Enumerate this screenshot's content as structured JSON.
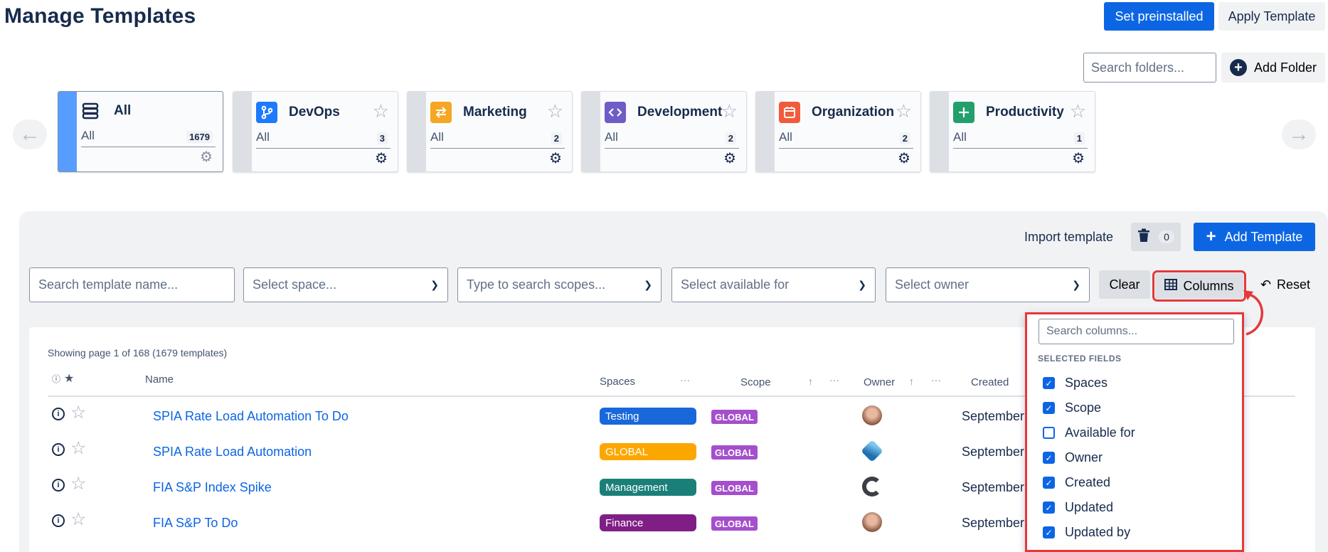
{
  "header": {
    "title": "Manage Templates",
    "set_preinstalled": "Set preinstalled",
    "apply_template": "Apply Template"
  },
  "folders_bar": {
    "search_placeholder": "Search folders...",
    "add_folder": "Add Folder"
  },
  "folders": [
    {
      "name": "All",
      "all_label": "All",
      "count": "1679",
      "icon": "stack-icon",
      "color": "#ffffff"
    },
    {
      "name": "DevOps",
      "all_label": "All",
      "count": "3",
      "icon": "git-branch-icon",
      "color": "#1d7afc"
    },
    {
      "name": "Marketing",
      "all_label": "All",
      "count": "2",
      "icon": "swap-arrows-icon",
      "color": "#f5a623"
    },
    {
      "name": "Development",
      "all_label": "All",
      "count": "2",
      "icon": "code-icon",
      "color": "#6e5dc6"
    },
    {
      "name": "Organization",
      "all_label": "All",
      "count": "2",
      "icon": "calendar-icon",
      "color": "#f15b3b"
    },
    {
      "name": "Productivity",
      "all_label": "All",
      "count": "1",
      "icon": "plus-icon",
      "color": "#22a06b"
    }
  ],
  "toolbar": {
    "import_template": "Import template",
    "trash_count": "0",
    "add_template": "Add Template"
  },
  "filters": {
    "name_placeholder": "Search template name...",
    "space_placeholder": "Select space...",
    "scope_placeholder": "Type to search scopes...",
    "available_placeholder": "Select available for",
    "owner_placeholder": "Select owner",
    "clear": "Clear",
    "columns": "Columns",
    "reset": "Reset"
  },
  "table": {
    "showing": "Showing page 1 of 168 (1679 templates)",
    "headers": {
      "name": "Name",
      "spaces": "Spaces",
      "scope": "Scope",
      "owner": "Owner",
      "created": "Created"
    },
    "rows": [
      {
        "name": "SPIA Rate Load Automation To Do",
        "space": "Testing",
        "space_color": "#1868db",
        "scope": "GLOBAL",
        "created": "September"
      },
      {
        "name": "SPIA Rate Load Automation",
        "space": "GLOBAL",
        "space_color": "#fca700",
        "scope": "GLOBAL",
        "created": "September"
      },
      {
        "name": "FIA S&P Index Spike",
        "space": "Management",
        "space_color": "#1b7f79",
        "scope": "GLOBAL",
        "created": "September"
      },
      {
        "name": "FIA S&P To Do",
        "space": "Finance",
        "space_color": "#7f1f86",
        "scope": "GLOBAL",
        "created": "September"
      }
    ]
  },
  "columns_dropdown": {
    "search_placeholder": "Search columns...",
    "section": "SELECTED FIELDS",
    "fields": [
      {
        "label": "Spaces",
        "checked": true
      },
      {
        "label": "Scope",
        "checked": true
      },
      {
        "label": "Available for",
        "checked": false
      },
      {
        "label": "Owner",
        "checked": true
      },
      {
        "label": "Created",
        "checked": true
      },
      {
        "label": "Updated",
        "checked": true
      },
      {
        "label": "Updated by",
        "checked": true
      }
    ]
  },
  "colors": {
    "primary": "#0c66e4",
    "highlight": "#e5383b",
    "scope_badge": "#a54fcc"
  }
}
